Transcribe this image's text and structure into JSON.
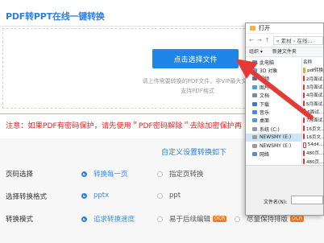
{
  "app": {
    "title": "PDF转PPT在线一键转换"
  },
  "upload": {
    "button_label": "点击选择文件",
    "hint_line1": "请上传需要转换的PDF文件，非VIP最大文件",
    "hint_line2": "支持PDF格式"
  },
  "warning": "注意：如果PDF有密码保护，请先使用＂PDF密码解除＂去除加密保护再",
  "settings": {
    "title": "自定义设置转换如下",
    "rows": [
      {
        "label": "页码选择",
        "options": [
          {
            "label": "转换每一页",
            "selected": true
          },
          {
            "label": "指定页转换",
            "selected": false
          }
        ]
      },
      {
        "label": "选择转换格式",
        "options": [
          {
            "label": "pptx",
            "selected": true
          },
          {
            "label": "ppt",
            "selected": false
          }
        ]
      },
      {
        "label": "转换模式",
        "options": [
          {
            "label": "追求转换速度",
            "selected": true
          },
          {
            "label": "易于后续编辑",
            "selected": false,
            "badge": "OCR"
          },
          {
            "label": "尽量保持排版",
            "selected": false,
            "badge": "OCR"
          }
        ]
      }
    ]
  },
  "dialog": {
    "title": "打开",
    "path": "« 素材 › 在线...",
    "toolbar": [
      "组织 ▾",
      "新建文件夹"
    ],
    "tree": [
      {
        "label": "此电脑",
        "color": "#4a8fd8",
        "selected": false
      },
      {
        "label": "3D 对象",
        "color": "#5aa0e0",
        "selected": false
      },
      {
        "label": "视频",
        "color": "#6a6a9a",
        "selected": false
      },
      {
        "label": "图片",
        "color": "#4aa0d0",
        "selected": false
      },
      {
        "label": "文档",
        "color": "#7a8aa0",
        "selected": false
      },
      {
        "label": "下载",
        "color": "#3a7ad0",
        "selected": false
      },
      {
        "label": "音乐",
        "color": "#4a8ad8",
        "selected": false
      },
      {
        "label": "桌面",
        "color": "#4a9ae0",
        "selected": false
      },
      {
        "label": "系统 (C:)",
        "color": "#8a9ab0",
        "selected": false
      },
      {
        "label": "NEWSMY (E:)",
        "color": "#9a9a9a",
        "selected": true
      },
      {
        "label": "NEWSMY (E:)",
        "color": "#9a9a9a",
        "selected": false
      },
      {
        "label": "网络",
        "color": "#5a8ad0",
        "selected": false
      }
    ],
    "files": [
      {
        "name": "名称",
        "folder": false,
        "header": true
      },
      {
        "name": "pdf转换",
        "folder": true
      },
      {
        "name": "2月面试...",
        "folder": false
      },
      {
        "name": "3月面试...",
        "folder": false
      },
      {
        "name": "4月面试...",
        "folder": false
      },
      {
        "name": "5月面试...",
        "folder": false
      },
      {
        "name": "6面试...",
        "folder": false
      },
      {
        "name": "7月面试...",
        "folder": false
      },
      {
        "name": "16页文...",
        "folder": false
      },
      {
        "name": "16页文...",
        "folder": false
      },
      {
        "name": "54d4...",
        "folder": false
      },
      {
        "name": "480页...",
        "folder": false
      },
      {
        "name": "480页...",
        "folder": false
      }
    ],
    "filename_label": "文件名(N):"
  },
  "colors": {
    "accent": "#2d7fe0",
    "button": "#1e86e8",
    "warning": "#e02424",
    "arrow": "#e53935",
    "ocr_badge": "#ff7a1a"
  }
}
